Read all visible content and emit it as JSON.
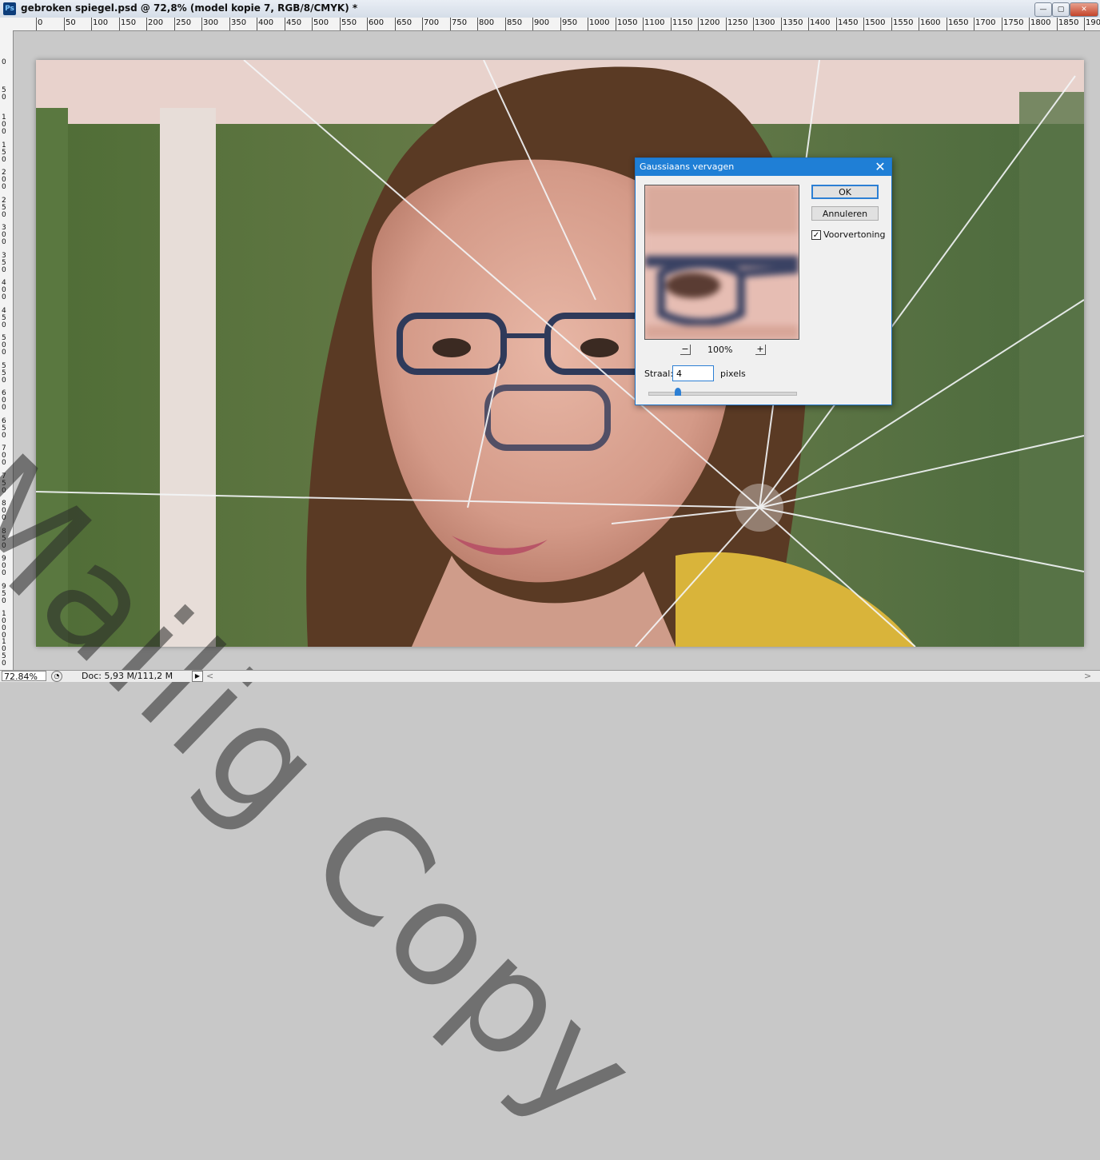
{
  "window": {
    "title": "gebroken spiegel.psd @ 72,8% (model kopie 7, RGB/8/CMYK) *",
    "app_icon": "Ps",
    "controls": {
      "minimize": "—",
      "maximize": "▢",
      "close": "✕"
    }
  },
  "rulers": {
    "top_labels": [
      "0",
      "50",
      "100",
      "150",
      "200",
      "250",
      "300",
      "350",
      "400",
      "450",
      "500",
      "550",
      "600",
      "650",
      "700",
      "750",
      "800",
      "850",
      "900",
      "950",
      "1000",
      "1050",
      "1100",
      "1150",
      "1200",
      "1250",
      "1300",
      "1350",
      "1400",
      "1450",
      "1500",
      "1550",
      "1600",
      "1650",
      "1700",
      "1750",
      "1800",
      "1850",
      "1900"
    ],
    "left_labels": [
      "0",
      "50",
      "100",
      "150",
      "200",
      "250",
      "300",
      "350",
      "400",
      "450",
      "500",
      "550",
      "600",
      "650",
      "700",
      "750",
      "800",
      "850",
      "900",
      "950",
      "1000",
      "1050"
    ]
  },
  "status": {
    "zoom": "72.84%",
    "doc": "Doc: 5,93 M/111,2 M",
    "arrow": "▶",
    "scroll_left": "<",
    "scroll_right": ">"
  },
  "dialog": {
    "title": "Gaussiaans vervagen",
    "close": "✕",
    "ok_label": "OK",
    "cancel_label": "Annuleren",
    "preview_label": "Voorvertoning",
    "preview_checked": "✓",
    "zoom_minus": "−",
    "zoom_plus": "+",
    "zoom_level": "100%",
    "radius_label": "Straal:",
    "radius_value": "4",
    "radius_unit": "pixels",
    "slider_level": 0.2
  },
  "watermark": "Mailig Copy",
  "colors": {
    "dialog_accent": "#1f7fd6",
    "title_close": "#c4452b"
  }
}
